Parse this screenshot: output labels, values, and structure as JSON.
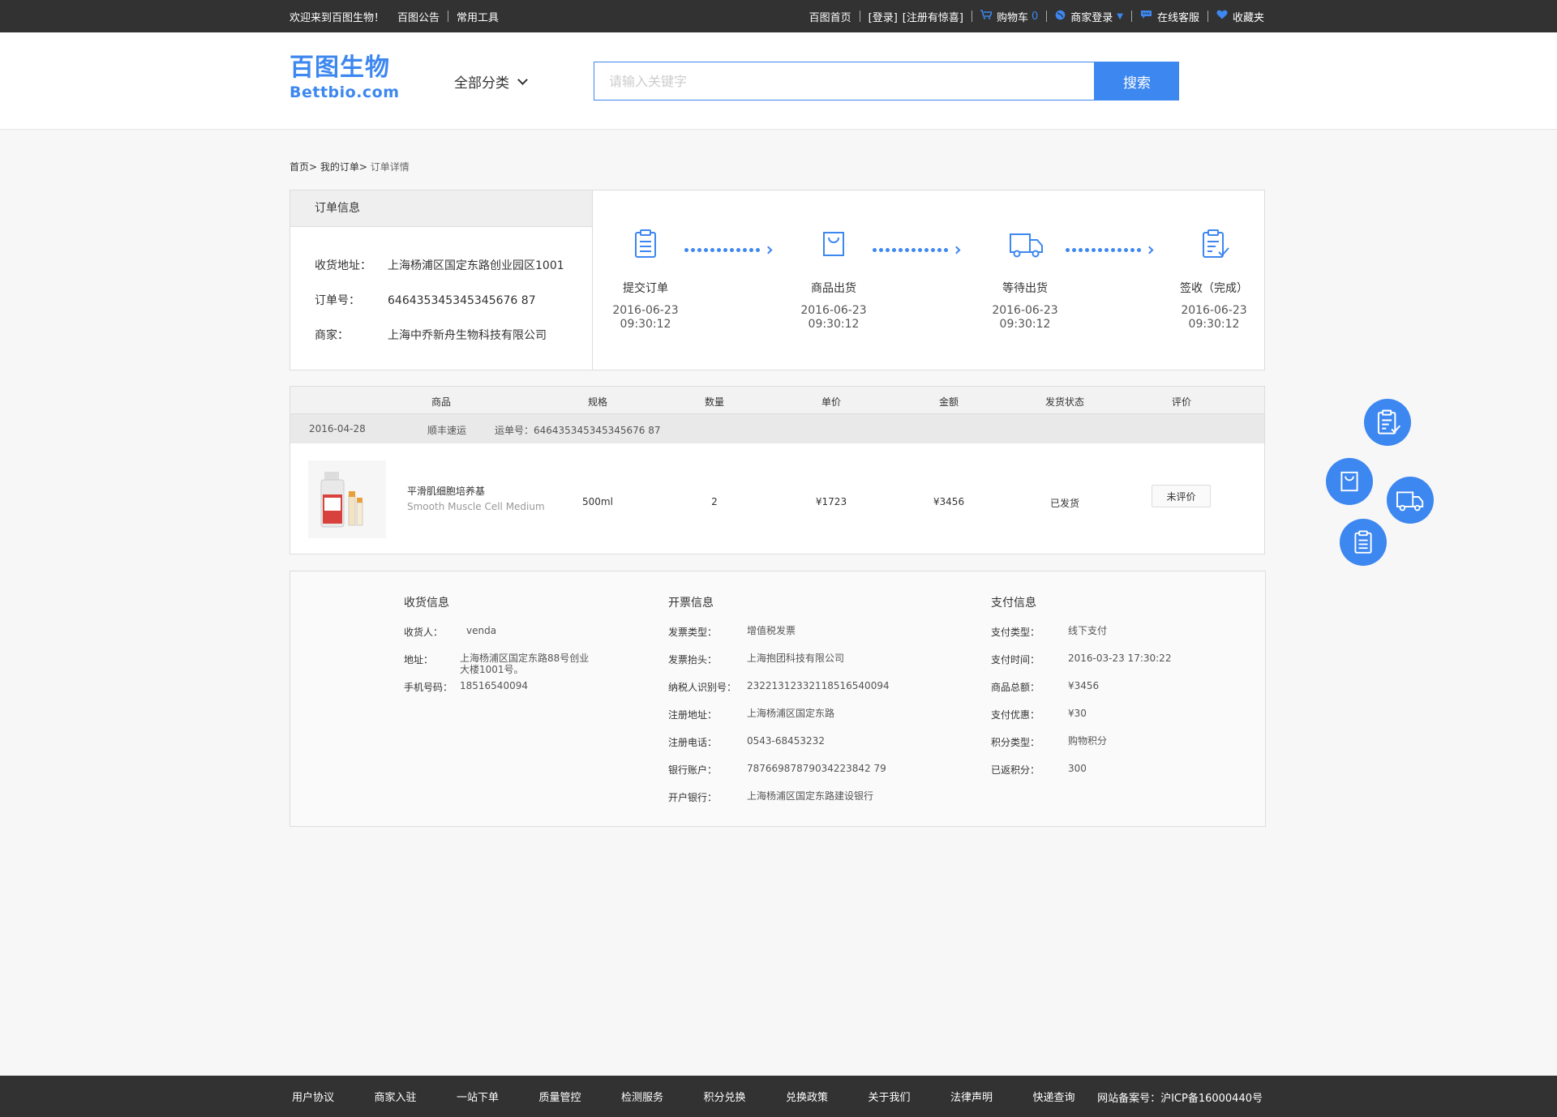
{
  "topbar": {
    "welcome": "欢迎来到百图生物！",
    "announce": "百图公告",
    "tools": "常用工具",
    "home": "百图首页",
    "login": "[登录]",
    "register": "[注册有惊喜]",
    "cart": "购物车",
    "cart_count": "0",
    "merchant_login": "商家登录",
    "service": "在线客服",
    "favorites": "收藏夹"
  },
  "header": {
    "logo_cn": "百图生物",
    "logo_en": "Bettbio.com",
    "category": "全部分类",
    "search_placeholder": "请输入关键字",
    "search_button": "搜索"
  },
  "breadcrumb": [
    "首页>",
    "我的订单>",
    "订单详情"
  ],
  "order_info": {
    "title": "订单信息",
    "address_label": "收货地址：",
    "address": "上海杨浦区国定东路创业园区1001",
    "order_no_label": "订单号：",
    "order_no": "646435345345345676 87",
    "merchant_label": "商家：",
    "merchant": "上海中乔新舟生物科技有限公司"
  },
  "steps": [
    {
      "label": "提交订单",
      "date": "2016-06-23",
      "time": "09:30:12"
    },
    {
      "label": "商品出货",
      "date": "2016-06-23",
      "time": "09:30:12"
    },
    {
      "label": "等待出货",
      "date": "2016-06-23",
      "time": "09:30:12"
    },
    {
      "label": "签收（完成）",
      "date": "2016-06-23",
      "time": "09:30:12"
    }
  ],
  "product_table": {
    "headers": [
      "商品",
      "规格",
      "数量",
      "单价",
      "金额",
      "发货状态",
      "评价"
    ],
    "ship_date": "2016-04-28",
    "carrier": "顺丰速运",
    "waybill": "运单号：646435345345345676 87",
    "item": {
      "name_cn": "平滑肌细胞培养基",
      "name_en": "Smooth Muscle Cell Medium",
      "spec": "500ml",
      "qty": "2",
      "price": "¥1723",
      "amount": "¥3456",
      "status": "已发货",
      "rate": "未评价"
    }
  },
  "receive": {
    "title": "收货信息",
    "rows": [
      {
        "k": "收货人：",
        "v": "venda"
      },
      {
        "k": "地址：",
        "v": "上海杨浦区国定东路88号创业大楼1001号。"
      },
      {
        "k": "手机号码：",
        "v": "18516540094"
      }
    ]
  },
  "invoice": {
    "title": "开票信息",
    "rows": [
      {
        "k": "发票类型：",
        "v": "增值税发票"
      },
      {
        "k": "发票抬头：",
        "v": "上海抱团科技有限公司"
      },
      {
        "k": "纳税人识别号：",
        "v": "23221312332118516540094"
      },
      {
        "k": "注册地址：",
        "v": "上海杨浦区国定东路"
      },
      {
        "k": "注册电话：",
        "v": "0543-68453232"
      },
      {
        "k": "银行账户：",
        "v": "78766987879034223842 79"
      },
      {
        "k": "开户银行：",
        "v": "上海杨浦区国定东路建设银行"
      }
    ]
  },
  "payment": {
    "title": "支付信息",
    "rows": [
      {
        "k": "支付类型：",
        "v": "线下支付"
      },
      {
        "k": "支付时间：",
        "v": "2016-03-23 17:30:22"
      },
      {
        "k": "商品总额：",
        "v": "¥3456"
      },
      {
        "k": "支付优惠：",
        "v": "¥30"
      },
      {
        "k": "积分类型：",
        "v": "购物积分"
      },
      {
        "k": "已返积分：",
        "v": "300"
      }
    ]
  },
  "footer": {
    "links": [
      "用户协议",
      "商家入驻",
      "一站下单",
      "质量管控",
      "检测服务",
      "积分兑换",
      "兑换政策",
      "关于我们",
      "法律声明",
      "快递查询"
    ],
    "icp": "网站备案号：沪ICP备16000440号"
  },
  "colors": {
    "accent": "#3d87f0",
    "dark": "#323232"
  }
}
